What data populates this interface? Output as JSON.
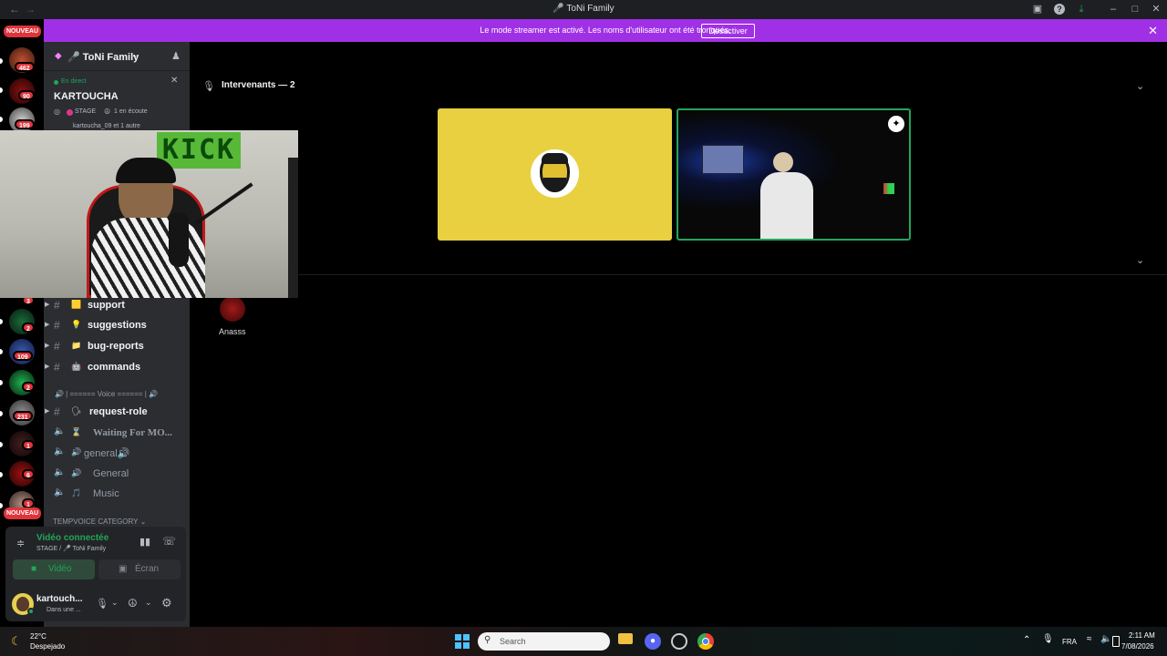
{
  "window": {
    "title": "🎤 ToNi Family"
  },
  "banner": {
    "message": "Le mode streamer est activé. Les noms d'utilisateur ont été tronqués.",
    "button": "Désactiver",
    "color": "#a030e6"
  },
  "rail": {
    "new_top": "NOUVEAU",
    "new_bottom": "NOUVEAU",
    "badges": [
      "462",
      "90",
      "199",
      "3",
      "2",
      "109",
      "2",
      "231",
      "1",
      "6",
      "1"
    ]
  },
  "server": {
    "name": "🎤 ToNi Family"
  },
  "live": {
    "status": "En direct",
    "title": "KARTOUCHA",
    "stage": "STAGE",
    "listeners": "1 en écoute",
    "speakers": "kartoucha_09 et 1 autre"
  },
  "channels": [
    {
      "type": "text",
      "emoji": "🟨",
      "name": "support"
    },
    {
      "type": "text",
      "emoji": "💡",
      "name": "suggestions"
    },
    {
      "type": "text",
      "emoji": "📁",
      "name": "bug-reports"
    },
    {
      "type": "text",
      "emoji": "🤖",
      "name": "commands"
    }
  ],
  "voice_category": "🔊 | ====== Voice ====== | 🔊",
  "voice_channels": [
    {
      "type": "text",
      "emoji": "🗣",
      "name": "request-role"
    },
    {
      "type": "voice",
      "emoji": "⌛",
      "name": "Waiting For MO..."
    },
    {
      "type": "voice",
      "emoji": "🔊",
      "name": "general🔊"
    },
    {
      "type": "voice",
      "emoji": "🔊",
      "name": "General"
    },
    {
      "type": "voice",
      "emoji": "🎵",
      "name": "Music"
    }
  ],
  "temp_category": "TEMPVOICE CATEGORY",
  "voice_panel": {
    "status": "Vidéo connectée",
    "location": "STAGE / 🎤 ToNi Family",
    "video_button": "Vidéo",
    "screen_button": "Écran",
    "status_color": "#23a55a"
  },
  "user": {
    "name": "kartouch...",
    "status": "Dans une ..."
  },
  "stage": {
    "speakers_header": "Intervenants — 2",
    "audience_name": "Anasss"
  },
  "taskbar": {
    "temp": "22°C",
    "weather": "Despejado",
    "search_placeholder": "Search",
    "lang": "FRA",
    "time": "2:11 AM",
    "date": "7/08/2026"
  }
}
